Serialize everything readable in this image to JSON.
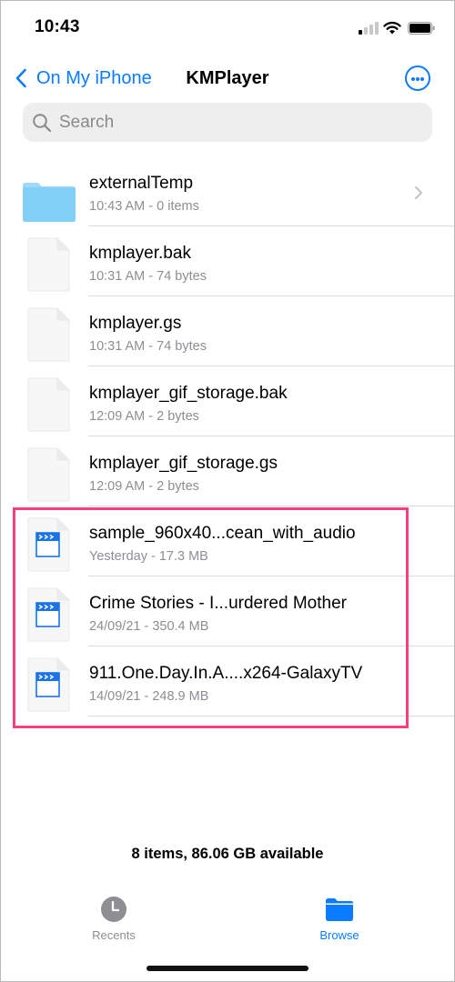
{
  "status_bar": {
    "time": "10:43",
    "signal_bars_active": 1,
    "signal_bars_total": 4,
    "icons": [
      "cellular-signal-icon",
      "wifi-icon",
      "battery-icon"
    ]
  },
  "nav": {
    "back_label": "On My iPhone",
    "title": "KMPlayer",
    "more_icon": "ellipsis-circle-icon",
    "accent_color": "#0a7aff"
  },
  "search": {
    "placeholder": "Search",
    "value": ""
  },
  "files": [
    {
      "name": "externalTemp",
      "meta": "10:43 AM - 0 items",
      "type": "folder"
    },
    {
      "name": "kmplayer.bak",
      "meta": "10:31 AM - 74 bytes",
      "type": "document"
    },
    {
      "name": "kmplayer.gs",
      "meta": "10:31 AM - 74 bytes",
      "type": "document"
    },
    {
      "name": "kmplayer_gif_storage.bak",
      "meta": "12:09 AM - 2 bytes",
      "type": "document"
    },
    {
      "name": "kmplayer_gif_storage.gs",
      "meta": "12:09 AM - 2 bytes",
      "type": "document"
    },
    {
      "name": "sample_960x40...cean_with_audio",
      "meta": "Yesterday - 17.3 MB",
      "type": "video"
    },
    {
      "name": "Crime Stories - I...urdered Mother",
      "meta": "24/09/21 - 350.4 MB",
      "type": "video"
    },
    {
      "name": "911.One.Day.In.A....x264-GalaxyTV",
      "meta": "14/09/21 - 248.9 MB",
      "type": "video"
    }
  ],
  "highlight_color": "#f5407f",
  "footer": {
    "summary": "8 items, 86.06 GB available"
  },
  "tabbar": {
    "tabs": [
      {
        "label": "Recents",
        "icon": "clock-icon",
        "selected": false
      },
      {
        "label": "Browse",
        "icon": "folder-icon",
        "selected": true
      }
    ]
  }
}
